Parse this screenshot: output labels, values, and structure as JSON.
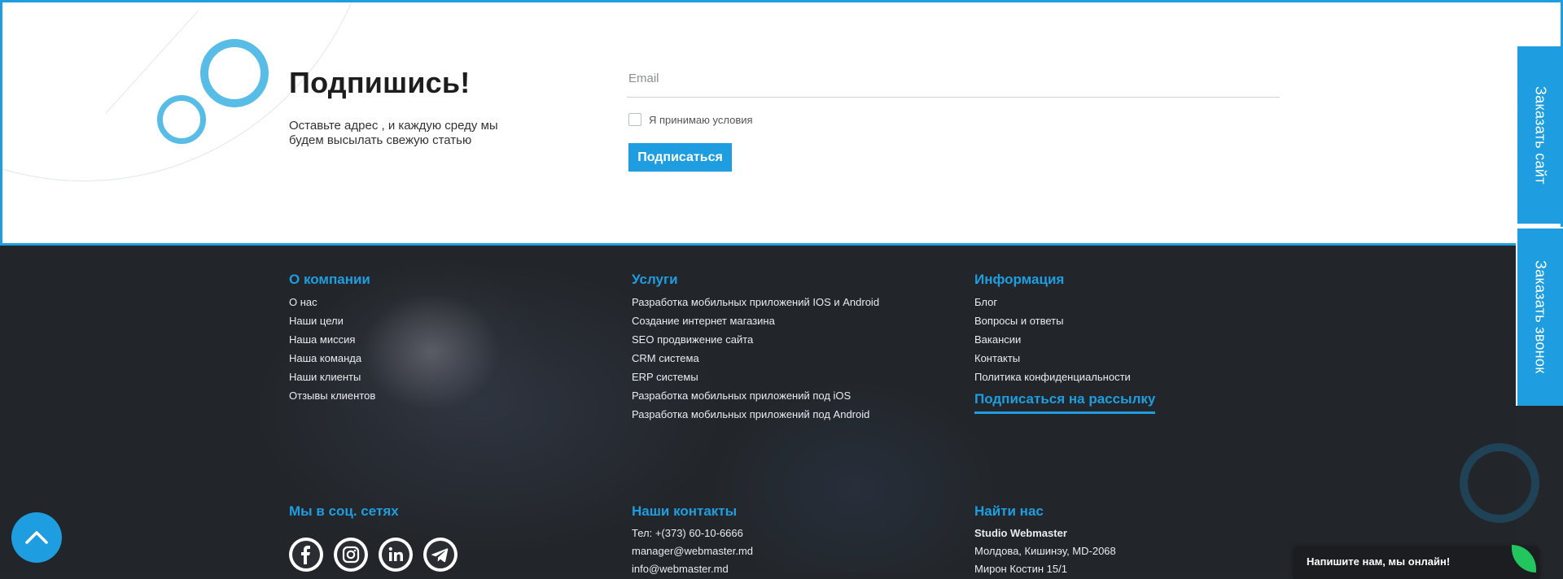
{
  "subscribe": {
    "title": "Подпишись!",
    "description": "Оставьте адрес , и каждую среду мы будем высылать свежую статью",
    "email_placeholder": "Email",
    "agree_label": "Я принимаю условия",
    "button_label": "Подписаться"
  },
  "side_tabs": {
    "order_site": "Заказать сайт",
    "order_call": "Заказать звонок"
  },
  "footer": {
    "about": {
      "title": "О компании",
      "links": [
        "О нас",
        "Наши цели",
        "Наша миссия",
        "Наша команда",
        "Наши клиенты",
        "Отзывы клиентов"
      ]
    },
    "services": {
      "title": "Услуги",
      "links": [
        "Разработка мобильных приложений IOS и Android",
        "Создание интернет магазина",
        "SEO продвижение сайта",
        "CRM система",
        "ERP системы",
        "Разработка мобильных приложений под iOS",
        "Разработка мобильных приложений под Android"
      ]
    },
    "info": {
      "title": "Информация",
      "links": [
        "Блог",
        "Вопросы и ответы",
        "Вакансии",
        "Контакты",
        "Политика конфиденциальности"
      ],
      "newsletter_link": "Подписаться на рассылку"
    },
    "social": {
      "title": "Мы в соц. сетях",
      "icons": [
        "facebook-icon",
        "instagram-icon",
        "linkedin-icon",
        "telegram-icon"
      ]
    },
    "contacts": {
      "title": "Наши контакты",
      "phone": "Тел: +(373) 60-10-6666",
      "email1": "manager@webmaster.md",
      "email2": "info@webmaster.md"
    },
    "find_us": {
      "title": "Найти нас",
      "company": "Studio Webmaster",
      "address1": "Молдова, Кишинэу, MD-2068",
      "address2": "Мирон Костин 15/1"
    }
  },
  "chat": {
    "text": "Напишите нам, мы онлайн!"
  },
  "colors": {
    "accent": "#1e9ee0",
    "ring": "#58bde6",
    "footer_bg": "#22262a",
    "chat_badge": "#22c55e"
  }
}
